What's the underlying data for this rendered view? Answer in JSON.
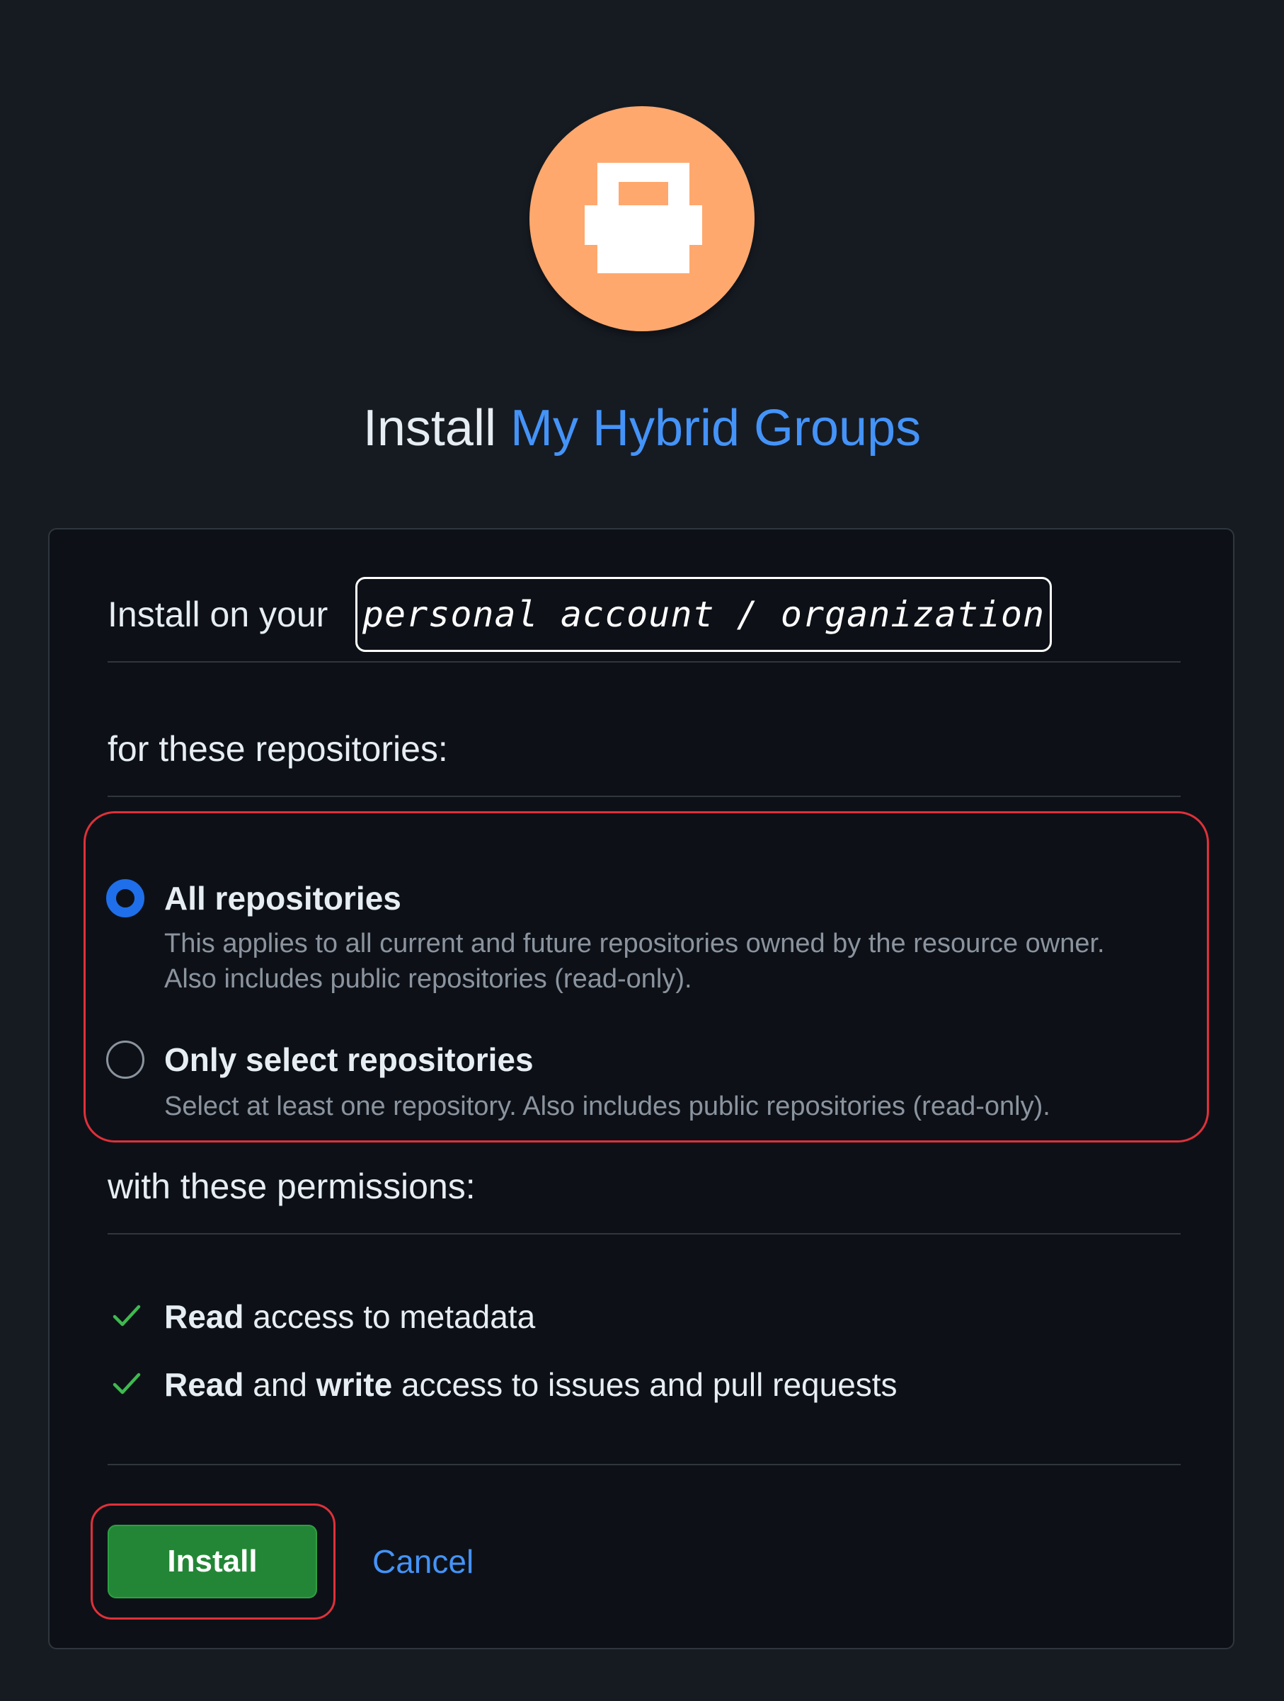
{
  "header": {
    "title_prefix": "Install",
    "app_name": "My Hybrid Groups",
    "avatar_icon": "app-identicon"
  },
  "account": {
    "label": "Install on your",
    "value": "personal account / organization"
  },
  "repositories": {
    "heading": "for these repositories:",
    "options": [
      {
        "label": "All repositories",
        "description": "This applies to all current and future repositories owned by the resource owner. Also includes public repositories (read-only).",
        "selected": true
      },
      {
        "label": "Only select repositories",
        "description": "Select at least one repository. Also includes public repositories (read-only).",
        "selected": false
      }
    ]
  },
  "permissions": {
    "heading": "with these permissions:",
    "items": [
      {
        "strong1": "Read",
        "text1": " access to metadata",
        "strong2": "",
        "text2": ""
      },
      {
        "strong1": "Read",
        "text1": " and ",
        "strong2": "write",
        "text2": " access to issues and pull requests"
      }
    ],
    "check_icon": "check-icon"
  },
  "actions": {
    "install_label": "Install",
    "cancel_label": "Cancel"
  },
  "colors": {
    "page_bg": "#161b22",
    "card_bg": "#0d1117",
    "accent_blue": "#4493f8",
    "install_green": "#238636",
    "avatar_orange": "#ffa86e",
    "highlight_red": "#e0303a"
  }
}
